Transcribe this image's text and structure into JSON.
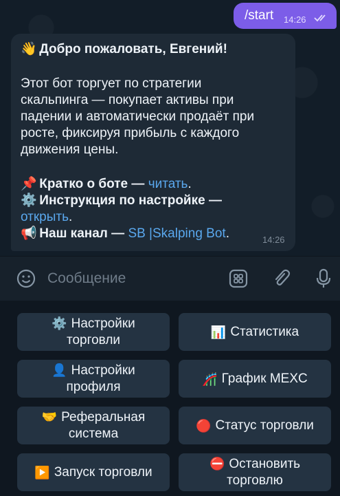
{
  "outgoing": {
    "text": "/start",
    "time": "14:26"
  },
  "incoming": {
    "greeting": "Добро пожаловать, Евгений!",
    "body_lines": [
      "Этот бот торгует по стратегии",
      "скальпинга — покупает активы при",
      "падении и автоматически продаёт при",
      "росте, фиксируя прибыль с каждого",
      "движения цены."
    ],
    "about_label": "Кратко о боте —",
    "about_link": "читать",
    "setup_label": "Инструкция по настройке —",
    "setup_link": "открыть",
    "channel_label": "Наш канал —",
    "channel_link": "SB |Skalping Bot",
    "time": "14:26"
  },
  "input": {
    "placeholder": "Сообщение"
  },
  "keyboard": {
    "trading_settings": [
      "Настройки",
      "торговли"
    ],
    "statistics": "Статистика",
    "profile_settings": [
      "Настройки",
      "профиля"
    ],
    "mexc_chart": "График MEXC",
    "referral": [
      "Реферальная",
      "система"
    ],
    "trading_status": "Статус торговли",
    "start_trading": "Запуск торговли",
    "stop_trading": [
      "Остановить",
      "торговлю"
    ]
  },
  "colors": {
    "outgoing_bubble": "#7c5de8",
    "incoming_bubble": "#1e2a36",
    "link": "#5aa8ee",
    "button": "#243342"
  },
  "icons": [
    "wave-hand-icon",
    "pushpin-icon",
    "gear-icon",
    "megaphone-icon",
    "smile-icon",
    "sticker-icon",
    "paperclip-icon",
    "microphone-icon",
    "bar-chart-icon",
    "user-icon",
    "chart-icon",
    "handshake-icon",
    "red-circle-icon",
    "play-icon",
    "stop-icon",
    "double-check-icon"
  ]
}
